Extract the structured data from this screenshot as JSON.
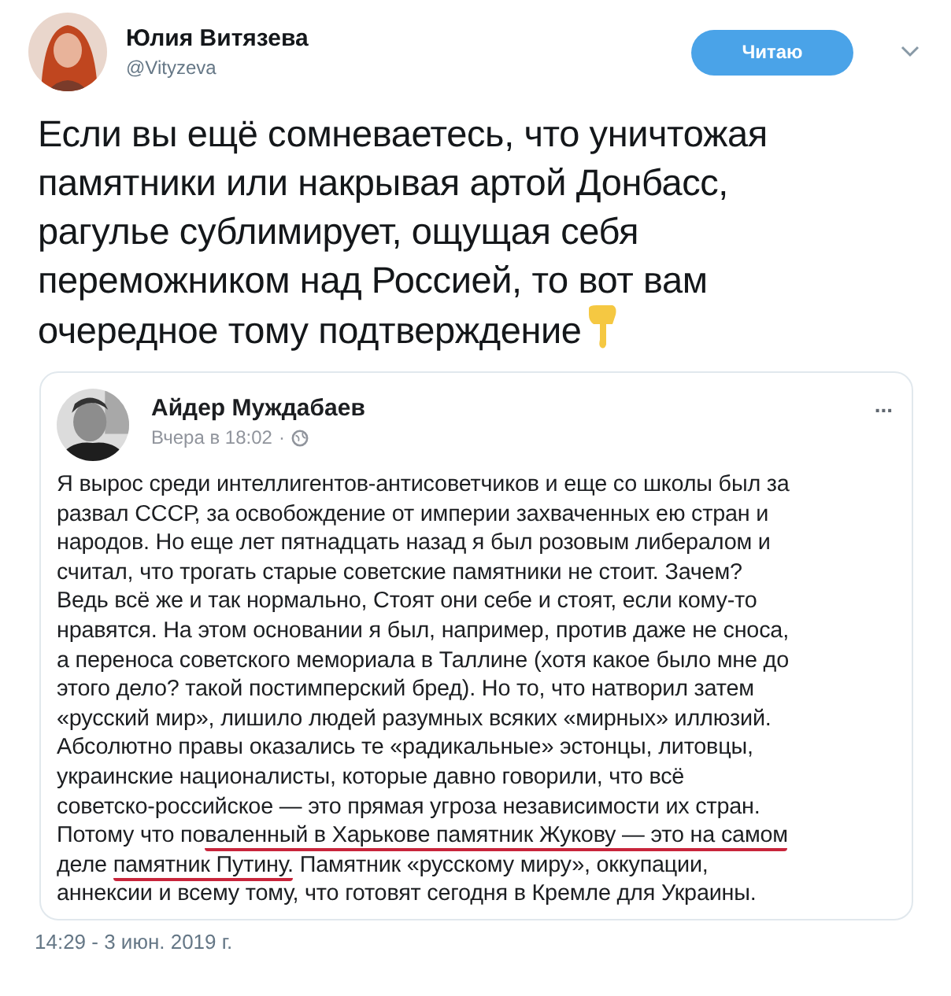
{
  "tweet": {
    "author": {
      "name": "Юлия Витязева",
      "handle": "@Vityzeva"
    },
    "follow_button": {
      "label": "Читаю"
    },
    "text_lines": [
      "Если вы ещё сомневаетесь, что уничтожая",
      "памятники или накрывая артой Донбасс,",
      "рагулье сублимирует, ощущая себя",
      "переможником над Россией, то вот вам",
      "очередное тому подтверждение"
    ],
    "embedded_post": {
      "author": "Айдер Муждабаев",
      "time": "Вчера в 18:02",
      "separator": "·",
      "menu": "...",
      "lines": [
        {
          "parts": [
            {
              "text": "Я вырос среди интеллигентов-антисоветчиков и еще со школы был за",
              "underlined": false
            }
          ]
        },
        {
          "parts": [
            {
              "text": "развал СССР, за освобождение от империи захваченных ею стран и",
              "underlined": false
            }
          ]
        },
        {
          "parts": [
            {
              "text": "народов. Но еще лет пятнадцать назад я был розовым либералом и",
              "underlined": false
            }
          ]
        },
        {
          "parts": [
            {
              "text": "считал, что трогать старые советские памятники не стоит. Зачем?",
              "underlined": false
            }
          ]
        },
        {
          "parts": [
            {
              "text": "Ведь всё же и так нормально, Стоят они себе и стоят, если кому-то",
              "underlined": false
            }
          ]
        },
        {
          "parts": [
            {
              "text": "нравятся. На этом основании я был, например, против даже не сноса,",
              "underlined": false
            }
          ]
        },
        {
          "parts": [
            {
              "text": "а переноса советского мемориала в Таллине (хотя какое было мне до",
              "underlined": false
            }
          ]
        },
        {
          "parts": [
            {
              "text": "этого дело? такой постимперский бред). Но то, что натворил затем",
              "underlined": false
            }
          ]
        },
        {
          "parts": [
            {
              "text": "«русский мир», лишило людей разумных всяких «мирных» иллюзий.",
              "underlined": false
            }
          ]
        },
        {
          "parts": [
            {
              "text": "Абсолютно правы оказались те «радикальные» эстонцы, литовцы,",
              "underlined": false
            }
          ]
        },
        {
          "parts": [
            {
              "text": "украинские националисты, которые давно говорили, что всё",
              "underlined": false
            }
          ]
        },
        {
          "parts": [
            {
              "text": "советско-российское — это прямая угроза независимости их стран.",
              "underlined": false
            }
          ]
        },
        {
          "parts": [
            {
              "text": "Потому что по",
              "underlined": false
            },
            {
              "text": "валенный в Харькове памятник Жукову — это на самом",
              "underlined": true
            }
          ]
        },
        {
          "parts": [
            {
              "text": "деле ",
              "underlined": false
            },
            {
              "text": "памятник Путину.",
              "underlined": true
            },
            {
              "text": " Памятник «русскому миру», оккупации,",
              "underlined": false
            }
          ]
        },
        {
          "parts": [
            {
              "text": "аннексии и всему тому, что готовят сегодня в Кремле для Украины.",
              "underlined": false
            }
          ]
        }
      ]
    },
    "timestamp": "14:29 - 3 июн. 2019 г."
  }
}
